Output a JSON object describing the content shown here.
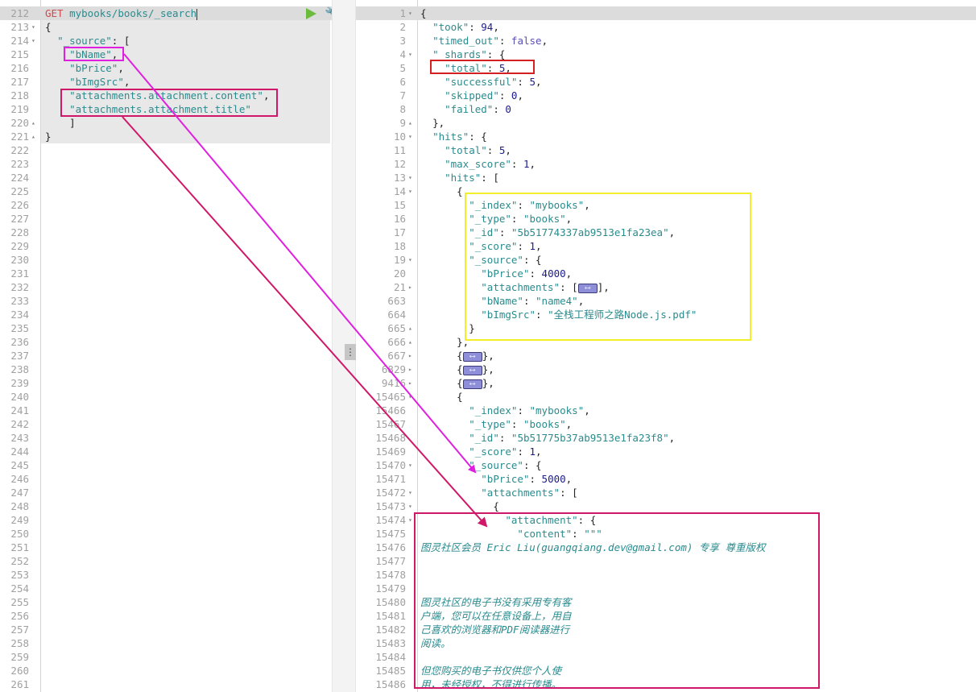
{
  "request_panel": {
    "method": "GET",
    "url": "mybooks/books/_search",
    "run_icon": "play-icon",
    "settings_icon": "wrench-icon",
    "lines": [
      {
        "num": "212",
        "fold": "",
        "code": ""
      },
      {
        "num": "213",
        "fold": "▾",
        "code": "{"
      },
      {
        "num": "214",
        "fold": "▾",
        "code": "  \"_source\": ["
      },
      {
        "num": "215",
        "fold": "",
        "code": "    \"bName\","
      },
      {
        "num": "216",
        "fold": "",
        "code": "    \"bPrice\","
      },
      {
        "num": "217",
        "fold": "",
        "code": "    \"bImgSrc\","
      },
      {
        "num": "218",
        "fold": "",
        "code": "    \"attachments.attachment.content\","
      },
      {
        "num": "219",
        "fold": "",
        "code": "    \"attachments.attachment.title\""
      },
      {
        "num": "220",
        "fold": "▴",
        "code": "    ]"
      },
      {
        "num": "221",
        "fold": "▴",
        "code": "}"
      }
    ],
    "empty_line_numbers": [
      "222",
      "223",
      "224",
      "225",
      "226",
      "227",
      "228",
      "229",
      "230",
      "231",
      "232",
      "233",
      "234",
      "235",
      "236",
      "237",
      "238",
      "239",
      "240",
      "241",
      "242",
      "243",
      "244",
      "245",
      "246",
      "247",
      "248",
      "249",
      "250",
      "251",
      "252",
      "253",
      "254",
      "255",
      "256",
      "257",
      "258",
      "259",
      "260",
      "261"
    ]
  },
  "response_panel": {
    "lines": [
      {
        "num": "1",
        "fold": "▾",
        "indent": 0,
        "html": "{"
      },
      {
        "num": "2",
        "fold": "",
        "indent": 1,
        "key": "took",
        "value": "94",
        "vtype": "n",
        "tail": ","
      },
      {
        "num": "3",
        "fold": "",
        "indent": 1,
        "key": "timed_out",
        "value": "false",
        "vtype": "b",
        "tail": ","
      },
      {
        "num": "4",
        "fold": "▾",
        "indent": 1,
        "key": "_shards",
        "value": "{",
        "vtype": "p",
        "tail": ""
      },
      {
        "num": "5",
        "fold": "",
        "indent": 2,
        "key": "total",
        "value": "5",
        "vtype": "n",
        "tail": ","
      },
      {
        "num": "6",
        "fold": "",
        "indent": 2,
        "key": "successful",
        "value": "5",
        "vtype": "n",
        "tail": ","
      },
      {
        "num": "7",
        "fold": "",
        "indent": 2,
        "key": "skipped",
        "value": "0",
        "vtype": "n",
        "tail": ","
      },
      {
        "num": "8",
        "fold": "",
        "indent": 2,
        "key": "failed",
        "value": "0",
        "vtype": "n",
        "tail": ""
      },
      {
        "num": "9",
        "fold": "▴",
        "indent": 1,
        "html": "},"
      },
      {
        "num": "10",
        "fold": "▾",
        "indent": 1,
        "key": "hits",
        "value": "{",
        "vtype": "p",
        "tail": ""
      },
      {
        "num": "11",
        "fold": "",
        "indent": 2,
        "key": "total",
        "value": "5",
        "vtype": "n",
        "tail": ","
      },
      {
        "num": "12",
        "fold": "",
        "indent": 2,
        "key": "max_score",
        "value": "1",
        "vtype": "n",
        "tail": ","
      },
      {
        "num": "13",
        "fold": "▾",
        "indent": 2,
        "key": "hits",
        "value": "[",
        "vtype": "p",
        "tail": ""
      },
      {
        "num": "14",
        "fold": "▾",
        "indent": 3,
        "html": "{"
      },
      {
        "num": "15",
        "fold": "",
        "indent": 4,
        "key": "_index",
        "value": "\"mybooks\"",
        "vtype": "s",
        "tail": ","
      },
      {
        "num": "16",
        "fold": "",
        "indent": 4,
        "key": "_type",
        "value": "\"books\"",
        "vtype": "s",
        "tail": ","
      },
      {
        "num": "17",
        "fold": "",
        "indent": 4,
        "key": "_id",
        "value": "\"5b51774337ab9513e1fa23ea\"",
        "vtype": "s",
        "tail": ","
      },
      {
        "num": "18",
        "fold": "",
        "indent": 4,
        "key": "_score",
        "value": "1",
        "vtype": "n",
        "tail": ","
      },
      {
        "num": "19",
        "fold": "▾",
        "indent": 4,
        "key": "_source",
        "value": "{",
        "vtype": "p",
        "tail": ""
      },
      {
        "num": "20",
        "fold": "",
        "indent": 5,
        "key": "bPrice",
        "value": "4000",
        "vtype": "n",
        "tail": ","
      },
      {
        "num": "21",
        "fold": "▸",
        "indent": 5,
        "key": "attachments",
        "value": "[",
        "vtype": "p",
        "collapsed": true,
        "close": "]",
        "tail": ","
      },
      {
        "num": "663",
        "fold": "",
        "indent": 5,
        "key": "bName",
        "value": "\"name4\"",
        "vtype": "s",
        "tail": ","
      },
      {
        "num": "664",
        "fold": "",
        "indent": 5,
        "key": "bImgSrc",
        "value": "\"全栈工程师之路Node.js.pdf\"",
        "vtype": "s",
        "tail": ""
      },
      {
        "num": "665",
        "fold": "▴",
        "indent": 4,
        "html": "}"
      },
      {
        "num": "666",
        "fold": "▴",
        "indent": 3,
        "html": "},"
      },
      {
        "num": "667",
        "fold": "▸",
        "indent": 3,
        "collapsed_obj": true
      },
      {
        "num": "6829",
        "fold": "▸",
        "indent": 3,
        "collapsed_obj": true
      },
      {
        "num": "9416",
        "fold": "▸",
        "indent": 3,
        "collapsed_obj": true
      },
      {
        "num": "15465",
        "fold": "▾",
        "indent": 3,
        "html": "{"
      },
      {
        "num": "15466",
        "fold": "",
        "indent": 4,
        "key": "_index",
        "value": "\"mybooks\"",
        "vtype": "s",
        "tail": ","
      },
      {
        "num": "15467",
        "fold": "",
        "indent": 4,
        "key": "_type",
        "value": "\"books\"",
        "vtype": "s",
        "tail": ","
      },
      {
        "num": "15468",
        "fold": "",
        "indent": 4,
        "key": "_id",
        "value": "\"5b51775b37ab9513e1fa23f8\"",
        "vtype": "s",
        "tail": ","
      },
      {
        "num": "15469",
        "fold": "",
        "indent": 4,
        "key": "_score",
        "value": "1",
        "vtype": "n",
        "tail": ","
      },
      {
        "num": "15470",
        "fold": "▾",
        "indent": 4,
        "key": "_source",
        "value": "{",
        "vtype": "p",
        "tail": ""
      },
      {
        "num": "15471",
        "fold": "",
        "indent": 5,
        "key": "bPrice",
        "value": "5000",
        "vtype": "n",
        "tail": ","
      },
      {
        "num": "15472",
        "fold": "▾",
        "indent": 5,
        "key": "attachments",
        "value": "[",
        "vtype": "p",
        "tail": ""
      },
      {
        "num": "15473",
        "fold": "▾",
        "indent": 6,
        "html": "{"
      },
      {
        "num": "15474",
        "fold": "▾",
        "indent": 7,
        "key": "attachment",
        "value": "{",
        "vtype": "p",
        "tail": ""
      },
      {
        "num": "15475",
        "fold": "",
        "indent": 8,
        "key": "content",
        "value": "\"\"\"",
        "vtype": "s",
        "tail": ""
      },
      {
        "num": "15476",
        "fold": "",
        "indent": 0,
        "text": "图灵社区会员 Eric Liu(guangqiang.dev@gmail.com) 专享 尊重版权"
      },
      {
        "num": "15477",
        "fold": "",
        "indent": 0,
        "text": ""
      },
      {
        "num": "15478",
        "fold": "",
        "indent": 0,
        "text": ""
      },
      {
        "num": "15479",
        "fold": "",
        "indent": 0,
        "text": ""
      },
      {
        "num": "15480",
        "fold": "",
        "indent": 0,
        "text": "图灵社区的电子书没有采用专有客"
      },
      {
        "num": "15481",
        "fold": "",
        "indent": 0,
        "text": "户端，您可以在任意设备上，用自"
      },
      {
        "num": "15482",
        "fold": "",
        "indent": 0,
        "text": "己喜欢的浏览器和PDF阅读器进行"
      },
      {
        "num": "15483",
        "fold": "",
        "indent": 0,
        "text": "阅读。"
      },
      {
        "num": "15484",
        "fold": "",
        "indent": 0,
        "text": ""
      },
      {
        "num": "15485",
        "fold": "",
        "indent": 0,
        "text": "但您购买的电子书仅供您个人使"
      },
      {
        "num": "15486",
        "fold": "",
        "indent": 0,
        "text": "用，未经授权，不得进行传播。"
      }
    ]
  },
  "splitter": {
    "handle_icon": "vertical-ellipsis-icon",
    "handle_glyph": "⋮"
  },
  "annotations": {
    "colors": {
      "magenta": "#e020e0",
      "crimson": "#d0186a",
      "red": "#d42020",
      "yellow": "#f2ee2a"
    }
  }
}
